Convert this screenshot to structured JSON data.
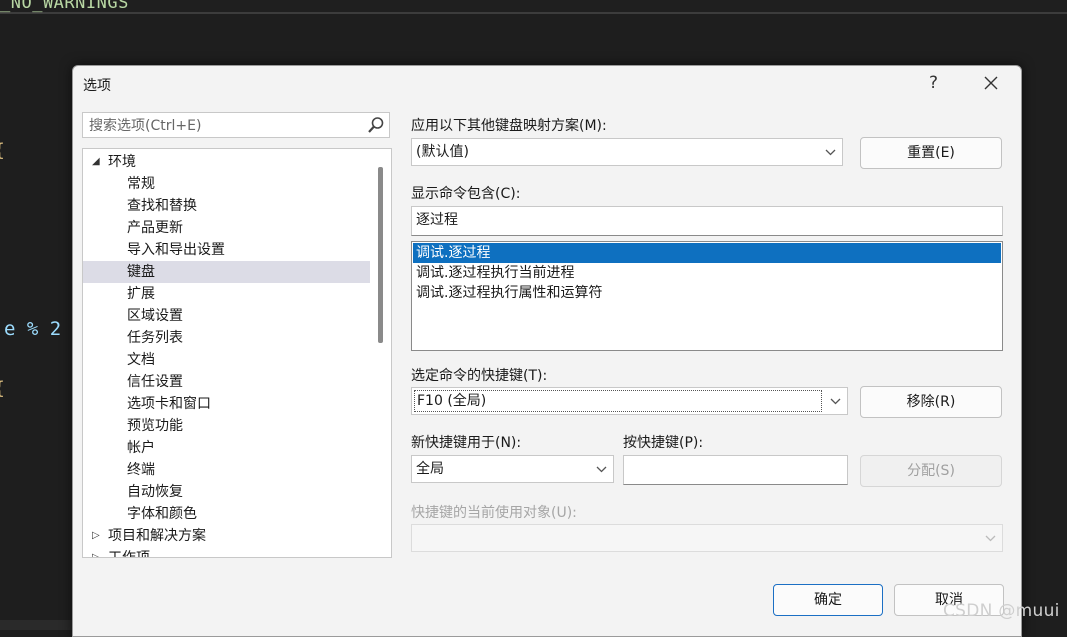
{
  "background": {
    "code_top": "_NO_WARNINGS",
    "code_brace": "{",
    "code_expr": "e % 2"
  },
  "dialog": {
    "title": "选项",
    "help_label": "?",
    "close_label": "✕"
  },
  "search": {
    "placeholder": "搜索选项(Ctrl+E)"
  },
  "tree": {
    "environment": "环境",
    "children": [
      "常规",
      "查找和替换",
      "产品更新",
      "导入和导出设置",
      "键盘",
      "扩展",
      "区域设置",
      "任务列表",
      "文档",
      "信任设置",
      "选项卡和窗口",
      "预览功能",
      "帐户",
      "终端",
      "自动恢复",
      "字体和颜色"
    ],
    "projects": "项目和解决方案",
    "work_items": "工作项"
  },
  "keyboard": {
    "mapping_label": "应用以下其他键盘映射方案(M):",
    "mapping_value": "(默认值)",
    "reset_button": "重置(E)",
    "contains_label": "显示命令包含(C):",
    "contains_value": "逐过程",
    "commands": [
      "调试.逐过程",
      "调试.逐过程执行当前进程",
      "调试.逐过程执行属性和运算符"
    ],
    "shortcut_label": "选定命令的快捷键(T):",
    "shortcut_value": "F10 (全局)",
    "remove_button": "移除(R)",
    "use_in_label": "新快捷键用于(N):",
    "use_in_value": "全局",
    "press_label": "按快捷键(P):",
    "press_value": "",
    "assign_button": "分配(S)",
    "used_by_label": "快捷键的当前使用对象(U):",
    "used_by_value": ""
  },
  "footer": {
    "ok_button": "确定",
    "cancel_button": "取消"
  },
  "watermark": "CSDN @muui"
}
